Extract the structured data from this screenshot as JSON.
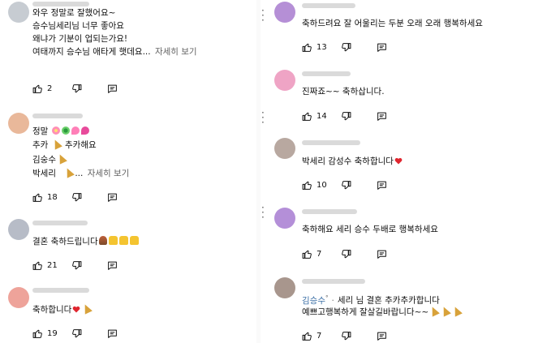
{
  "icons": {
    "like": "thumbs-up-icon",
    "dislike": "thumbs-down-icon",
    "reply": "reply-comment-icon",
    "more": "more-vertical-icon",
    "party": "party-popper-emoji",
    "heart": "red-heart-emoji"
  },
  "colors": {
    "text": "#0f0f0f",
    "secondary": "#606060",
    "author_link": "#3a6ea5",
    "heart": "#e0262f"
  },
  "left_comments": [
    {
      "avatar_color": "#c7ccd2",
      "lines": [
        "와우  정말로  잘했어요~",
        "승수님세리님  너무 좋아요",
        "왜냐가 기분이 업되는가요!",
        "여태까지  승수님  애타게 햇데요..."
      ],
      "more_label": "자세히 보기",
      "likes": "2"
    },
    {
      "avatar_color": "#e9b89a",
      "lines": [
        "정말",
        "추카",
        "추카해요",
        "김숭수",
        "박세리"
      ],
      "more_label": "자세히 보기",
      "likes": "18"
    },
    {
      "avatar_color": "#b7bcc7",
      "lines": [
        "결혼  축하드립니다"
      ],
      "likes": "21"
    },
    {
      "avatar_color": "#eea39a",
      "lines": [
        "축하합니다"
      ],
      "likes": "19"
    }
  ],
  "right_comments": [
    {
      "avatar_color": "#b58fd6",
      "lines": [
        "축하드려요 잘 어울리는 두분 오래 오래 행복하세요"
      ],
      "likes": "13"
    },
    {
      "avatar_color": "#efa4c5",
      "lines": [
        "진짜죠~~ 축하삽니다."
      ],
      "likes": "14"
    },
    {
      "avatar_color": "#b8a8a0",
      "lines": [
        "박세리 감성수 축하합니다"
      ],
      "likes": "10"
    },
    {
      "avatar_color": "#b48fd8",
      "lines": [
        "축하해요 세리 승수 두배로 행복하세요"
      ],
      "likes": "7"
    },
    {
      "avatar_color": "#a8968d",
      "author": "김승수",
      "author_mark": "°",
      "reply_text": "세리 님 결혼 추카추카합니다",
      "lines": [
        "예쁘고행복하게 잘살길바랍니다~~"
      ],
      "likes": "7"
    }
  ]
}
